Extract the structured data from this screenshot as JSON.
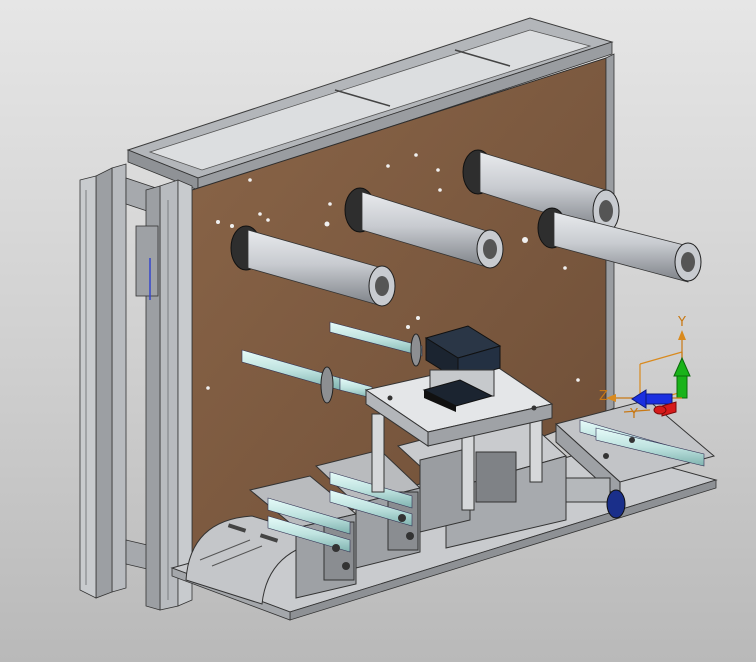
{
  "viewport": {
    "background_top": "#e6e6e6",
    "background_bottom": "#b9b9b9"
  },
  "model": {
    "panel_color": "#7a573f",
    "frame_color": "#a9acb0",
    "roller_color": "#c8cbd0",
    "shaft_color": "#bfe3e0",
    "base_color": "#bdbfc2",
    "motor_color": "#1e2a3a"
  },
  "triad": {
    "y_label": "Y",
    "z_label": "Z",
    "x_label": "Y",
    "colors": {
      "y": "#19b319",
      "z": "#1a2fe0",
      "x": "#d61a1a",
      "labels": "#c87814"
    }
  }
}
